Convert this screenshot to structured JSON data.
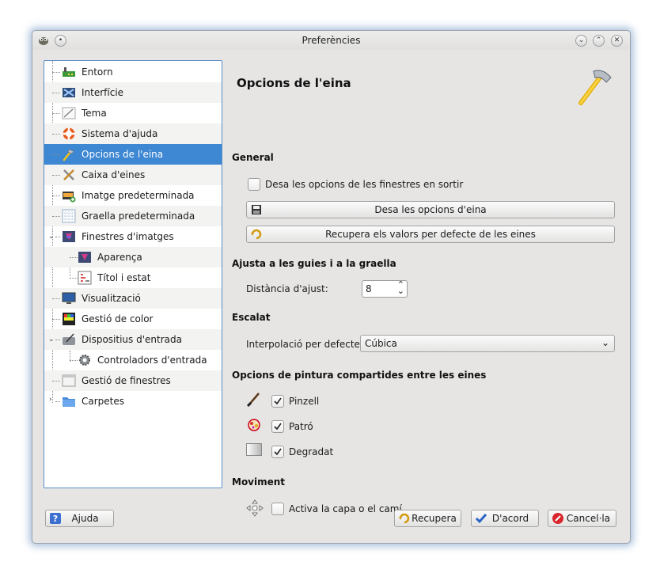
{
  "window": {
    "title": "Preferències"
  },
  "sidebar": {
    "items": [
      {
        "label": "Entorn"
      },
      {
        "label": "Interfície"
      },
      {
        "label": "Tema"
      },
      {
        "label": "Sistema d'ajuda"
      },
      {
        "label": "Opcions de l'eina"
      },
      {
        "label": "Caixa d'eines"
      },
      {
        "label": "Imatge predeterminada"
      },
      {
        "label": "Graella predeterminada"
      },
      {
        "label": "Finestres d'imatges"
      },
      {
        "label": "Aparença"
      },
      {
        "label": "Títol i estat"
      },
      {
        "label": "Visualització"
      },
      {
        "label": "Gestió de color"
      },
      {
        "label": "Dispositius d'entrada"
      },
      {
        "label": "Controladors d'entrada"
      },
      {
        "label": "Gestió de finestres"
      },
      {
        "label": "Carpetes"
      }
    ],
    "selected": "Opcions de l'eina"
  },
  "page": {
    "title": "Opcions de l'eina"
  },
  "general": {
    "heading": "General",
    "save_on_exit_label": "Desa les opcions de les finestres en sortir",
    "save_on_exit_checked": false,
    "save_options_button": "Desa les opcions d'eina",
    "reset_defaults_button": "Recupera els valors per defecte de les eines"
  },
  "snap": {
    "heading": "Ajusta a les guies i a la graella",
    "distance_label": "Distància d'ajust:",
    "distance_value": "8"
  },
  "scaling": {
    "heading": "Escalat",
    "interp_label": "Interpolació per defecte:",
    "interp_value": "Cúbica"
  },
  "paint": {
    "heading": "Opcions de pintura compartides entre les eines",
    "brush_label": "Pinzell",
    "brush_checked": true,
    "pattern_label": "Patró",
    "pattern_checked": true,
    "gradient_label": "Degradat",
    "gradient_checked": true
  },
  "move": {
    "heading": "Moviment",
    "activate_label": "Activa la capa o el camí",
    "activate_checked": false
  },
  "footer": {
    "help": "Ajuda",
    "reset": "Recupera",
    "ok": "D'acord",
    "cancel": "Cancel·la"
  },
  "colors": {
    "selection": "#3d87d3",
    "border_accent": "#5a8ec6"
  }
}
